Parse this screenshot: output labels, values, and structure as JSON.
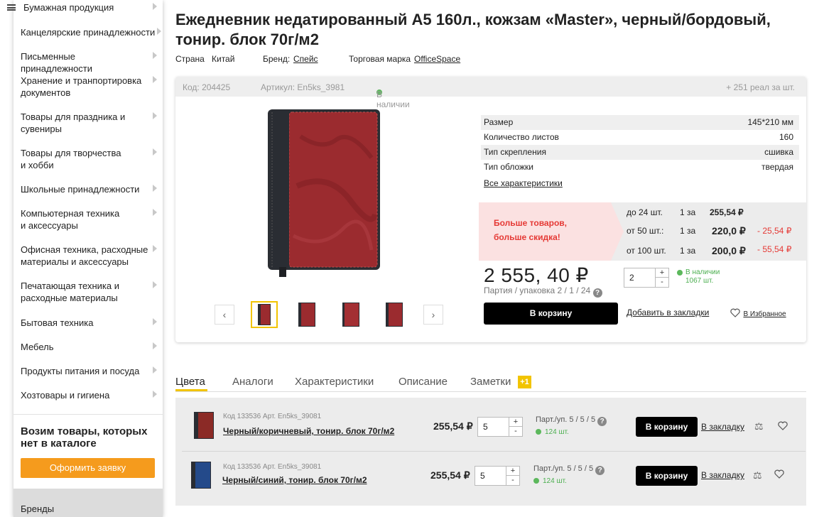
{
  "sidebar": {
    "items": [
      {
        "label": "Бумажная продукция"
      },
      {
        "label": "Канцелярские принадлежности"
      },
      {
        "label": "Письменные принадлежности"
      },
      {
        "label": "Хранение и транпортировка документов"
      },
      {
        "label": "Товары для праздника и сувениры"
      },
      {
        "label": "Товары для творчества и хобби"
      },
      {
        "label": "Школьные принадлежности"
      },
      {
        "label": "Компьютерная техника и аксессуары"
      },
      {
        "label": "Офисная техника, расходные материалы и аксессуары"
      },
      {
        "label": "Печатающая техника и расходные материалы"
      },
      {
        "label": "Бытовая техника"
      },
      {
        "label": "Мебель"
      },
      {
        "label": "Продукты питания и посуда"
      },
      {
        "label": "Хозтовары и гигиена"
      }
    ],
    "promo_text": "Возим товары, которых нет в каталоге",
    "promo_button": "Оформить заявку",
    "bottom_label": "Бренды"
  },
  "product": {
    "title": "Ежедневник недатированный А5 160л., кожзам «Master», черный/бордовый, тонир. блок 70г/м2",
    "country_label": "Страна",
    "country": "Китай",
    "brand_label": "Бренд:",
    "brand": "Спейс",
    "trademark_label": "Торговая марка",
    "trademark": "OfficeSpace",
    "code": "Код: 204425",
    "article": "Артикул: En5ks_3981",
    "availability": "В наличии",
    "bonus": "+ 251 реал за шт.",
    "colors": {
      "cover": "#9b2b2f",
      "spine": "#2a2d33",
      "accent": "#f2c400",
      "cart": "#000000",
      "promo": "#f59b1d"
    },
    "specs": [
      {
        "k": "Размер",
        "v": "145*210 мм"
      },
      {
        "k": "Количество листов",
        "v": "160"
      },
      {
        "k": "Тип скрепления",
        "v": "сшивка"
      },
      {
        "k": "Тип обложки",
        "v": "твердая"
      }
    ],
    "all_chars": "Все характеристики",
    "promo": {
      "line1": "Больше товаров,",
      "line2": "больше скидка!"
    },
    "tiers": [
      {
        "qty": "до 24 шт.",
        "per": "1 за",
        "price": "255,54 ₽",
        "diff": ""
      },
      {
        "qty": "от 50 шт.:",
        "per": "1 за",
        "price": "220,0 ₽",
        "diff": "- 25,54 ₽"
      },
      {
        "qty": "от 100 шт.",
        "per": "1 за",
        "price": "200,0 ₽",
        "diff": "- 55,54 ₽"
      }
    ],
    "price": "2 555, 40 ₽",
    "batch": "Партия / упаковка   2 / 1 / 24",
    "qty": "2",
    "stock_label": "В наличии",
    "stock_count": "1067 шт.",
    "cart_button": "В корзину",
    "bookmark": "Добавить в закладки",
    "favorite": "В Избранное"
  },
  "tabs": [
    {
      "label": "Цвета"
    },
    {
      "label": "Аналоги"
    },
    {
      "label": "Характеристики"
    },
    {
      "label": "Описание"
    },
    {
      "label": "Заметки"
    }
  ],
  "notes_badge": "+1",
  "variants": [
    {
      "meta": "Код 133536   Арт. En5ks_39081",
      "name": "Черный/коричневый, тонир. блок 70г/м2",
      "price": "255,54 ₽",
      "qty": "5",
      "part": "Парт./уп.  5 / 5 / 5",
      "stock": "124 шт.",
      "cart": "В корзину",
      "bookmark": "В закладку",
      "color": "#8b2a26"
    },
    {
      "meta": "Код 133536   Арт. En5ks_39081",
      "name": "Черный/синий, тонир. блок 70г/м2",
      "price": "255,54 ₽",
      "qty": "5",
      "part": "Парт./уп.  5 / 5 / 5",
      "stock": "124 шт.",
      "cart": "В корзину",
      "bookmark": "В закладку",
      "color": "#244a8a"
    }
  ]
}
